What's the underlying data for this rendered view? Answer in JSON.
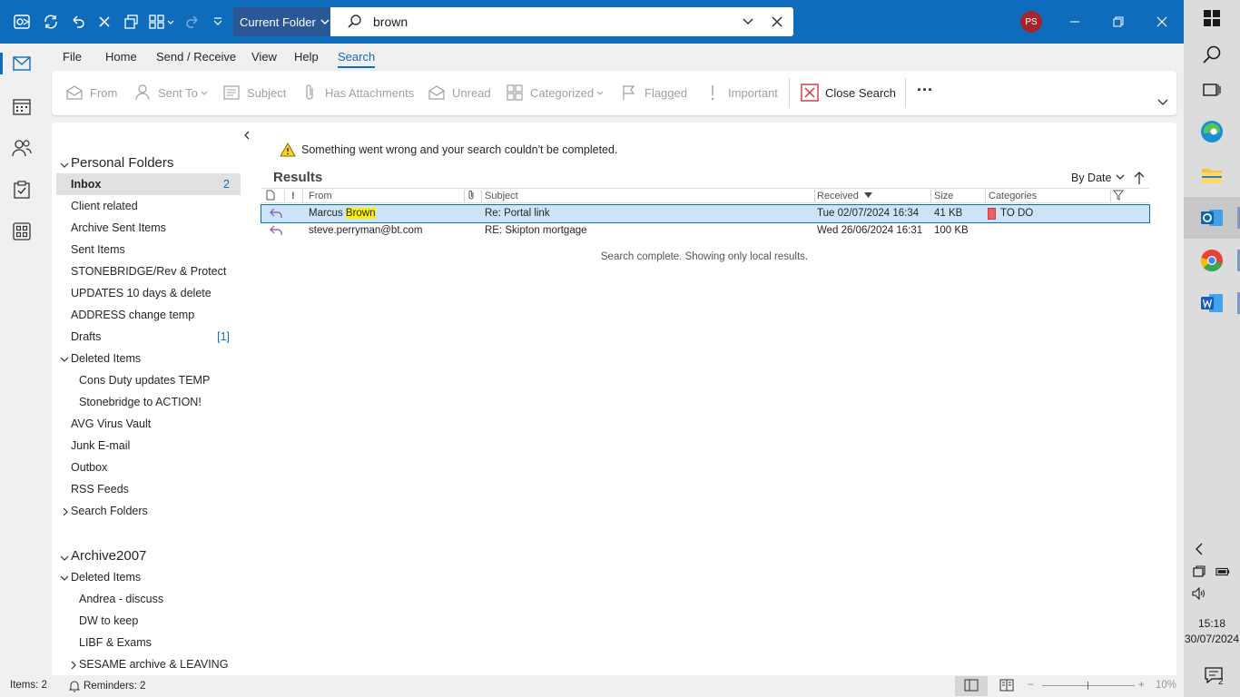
{
  "titlebar": {
    "scope": "Current Folder",
    "search_value": "brown",
    "user_initials": "PS",
    "accent": "#0f6cbd"
  },
  "menu": {
    "tabs": [
      "File",
      "Home",
      "Send / Receive",
      "View",
      "Help",
      "Search"
    ],
    "active": "Search"
  },
  "ribbon": {
    "from": "From",
    "sent_to": "Sent To",
    "subject": "Subject",
    "has_attachments": "Has Attachments",
    "unread": "Unread",
    "categorized": "Categorized",
    "flagged": "Flagged",
    "important": "Important",
    "close_search": "Close Search",
    "more": "···"
  },
  "folders": {
    "personal": {
      "title": "Personal Folders",
      "items": [
        {
          "name": "Inbox",
          "count": "2"
        },
        {
          "name": "Client related"
        },
        {
          "name": "Archive Sent Items"
        },
        {
          "name": "Sent Items"
        },
        {
          "name": "STONEBRIDGE/Rev & Protect"
        },
        {
          "name": "UPDATES 10 days & delete"
        },
        {
          "name": "ADDRESS change temp"
        },
        {
          "name": "Drafts",
          "count": "[1]"
        },
        {
          "name": "Deleted Items"
        },
        {
          "name": "Cons Duty updates TEMP"
        },
        {
          "name": "Stonebridge to ACTION!"
        },
        {
          "name": "AVG Virus Vault"
        },
        {
          "name": "Junk E-mail"
        },
        {
          "name": "Outbox"
        },
        {
          "name": "RSS Feeds"
        },
        {
          "name": "Search Folders"
        }
      ]
    },
    "archive": {
      "title": "Archive2007",
      "items": [
        {
          "name": "Deleted Items"
        },
        {
          "name": "Andrea - discuss"
        },
        {
          "name": "DW to keep"
        },
        {
          "name": "LIBF & Exams"
        },
        {
          "name": "SESAME archive & LEAVING"
        }
      ]
    }
  },
  "results": {
    "warning": "Something went wrong and your search couldn't be completed.",
    "title": "Results",
    "sort_label": "By Date",
    "columns": {
      "important": "!",
      "from": "From",
      "subject": "Subject",
      "received": "Received",
      "size": "Size",
      "categories": "Categories"
    },
    "rows": [
      {
        "from_pre": "Marcus ",
        "from_hl": "Brown",
        "subject": "Re: Portal link",
        "received": "Tue 02/07/2024 16:34",
        "size": "41 KB",
        "category": "TO DO"
      },
      {
        "from_pre": "steve.perryman@bt.com",
        "from_hl": "",
        "subject": "RE: Skipton mortgage",
        "received": "Wed 26/06/2024 16:31",
        "size": "100 KB",
        "category": ""
      }
    ],
    "complete_msg": "Search complete. Showing only local results."
  },
  "statusbar": {
    "items": "Items: 2",
    "reminders": "Reminders: 2",
    "zoom": "10%"
  },
  "taskbar": {
    "time": "15:18",
    "date": "30/07/2024",
    "notifications": "2"
  }
}
